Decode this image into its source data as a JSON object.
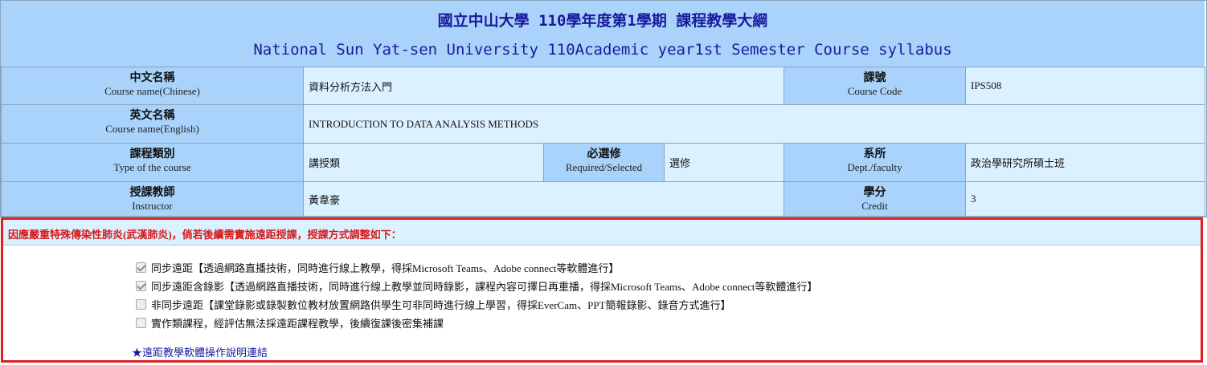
{
  "header": {
    "title_zh": "國立中山大學 110學年度第1學期 課程教學大綱",
    "title_en": "National Sun Yat-sen University 110Academic year1st Semester Course syllabus"
  },
  "fields": {
    "name_zh": {
      "label_zh": "中文名稱",
      "label_en": "Course name(Chinese)",
      "value": "資料分析方法入門"
    },
    "code": {
      "label_zh": "課號",
      "label_en": "Course Code",
      "value": "IPS508"
    },
    "name_en": {
      "label_zh": "英文名稱",
      "label_en": "Course name(English)",
      "value": "INTRODUCTION TO DATA ANALYSIS METHODS"
    },
    "type": {
      "label_zh": "課程類別",
      "label_en": "Type of the course",
      "value": "講授類"
    },
    "required": {
      "label_zh": "必選修",
      "label_en": "Required/Selected",
      "value": "選修"
    },
    "dept": {
      "label_zh": "系所",
      "label_en": "Dept./faculty",
      "value": "政治學研究所碩士班"
    },
    "instructor": {
      "label_zh": "授課教師",
      "label_en": "Instructor",
      "value": "黃韋豪"
    },
    "credit": {
      "label_zh": "學分",
      "label_en": "Credit",
      "value": "3"
    }
  },
  "notice": {
    "heading": "因應嚴重特殊傳染性肺炎(武漢肺炎)，倘若後續需實施遠距授課，授課方式調整如下：",
    "options": [
      {
        "label": "同步遠距【透過網路直播技術，同時進行線上教學，得採Microsoft Teams、Adobe connect等軟體進行】",
        "checked": true
      },
      {
        "label": "同步遠距含錄影【透過網路直播技術，同時進行線上教學並同時錄影，課程內容可擇日再重播，得採Microsoft Teams、Adobe connect等軟體進行】",
        "checked": true
      },
      {
        "label": "非同步遠距【課堂錄影或錄製數位教材放置網路供學生可非同時進行線上學習，得採EverCam、PPT簡報錄影、錄音方式進行】",
        "checked": false
      },
      {
        "label": "實作類課程，經評估無法採遠距課程教學，後續復課後密集補課",
        "checked": false
      }
    ],
    "link": "★遠距教學軟體操作說明連結"
  }
}
